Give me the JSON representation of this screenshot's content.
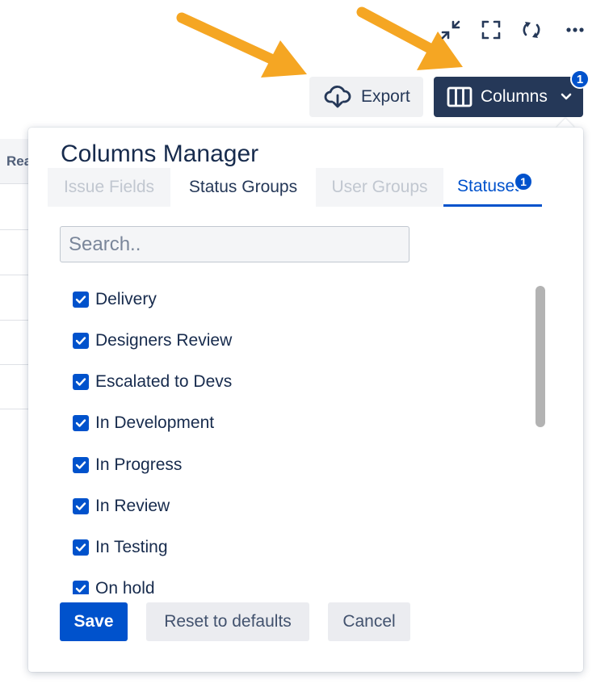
{
  "toolbar": {
    "icons": [
      "collapse-icon",
      "fullscreen-icon",
      "refresh-icon",
      "more-icon"
    ],
    "export_label": "Export",
    "columns_label": "Columns",
    "columns_badge": "1"
  },
  "background_table": {
    "header_partial": "Rea"
  },
  "panel": {
    "title": "Columns Manager",
    "tabs": [
      {
        "label": "Issue Fields",
        "state": "disabled"
      },
      {
        "label": "Status Groups",
        "state": "normal"
      },
      {
        "label": "User Groups",
        "state": "disabled"
      },
      {
        "label": "Statuses",
        "state": "active",
        "badge": "1"
      }
    ],
    "search_placeholder": "Search..",
    "statuses": [
      {
        "label": "Delivery",
        "checked": true
      },
      {
        "label": "Designers Review",
        "checked": true
      },
      {
        "label": "Escalated to Devs",
        "checked": true
      },
      {
        "label": "In Development",
        "checked": true
      },
      {
        "label": "In Progress",
        "checked": true
      },
      {
        "label": "In Review",
        "checked": true
      },
      {
        "label": "In Testing",
        "checked": true
      },
      {
        "label": "On hold",
        "checked": true
      }
    ],
    "save_label": "Save",
    "reset_label": "Reset to defaults",
    "cancel_label": "Cancel"
  },
  "colors": {
    "primary": "#0052cc",
    "dark_button": "#253858",
    "annotation_arrow": "#f5a623"
  }
}
